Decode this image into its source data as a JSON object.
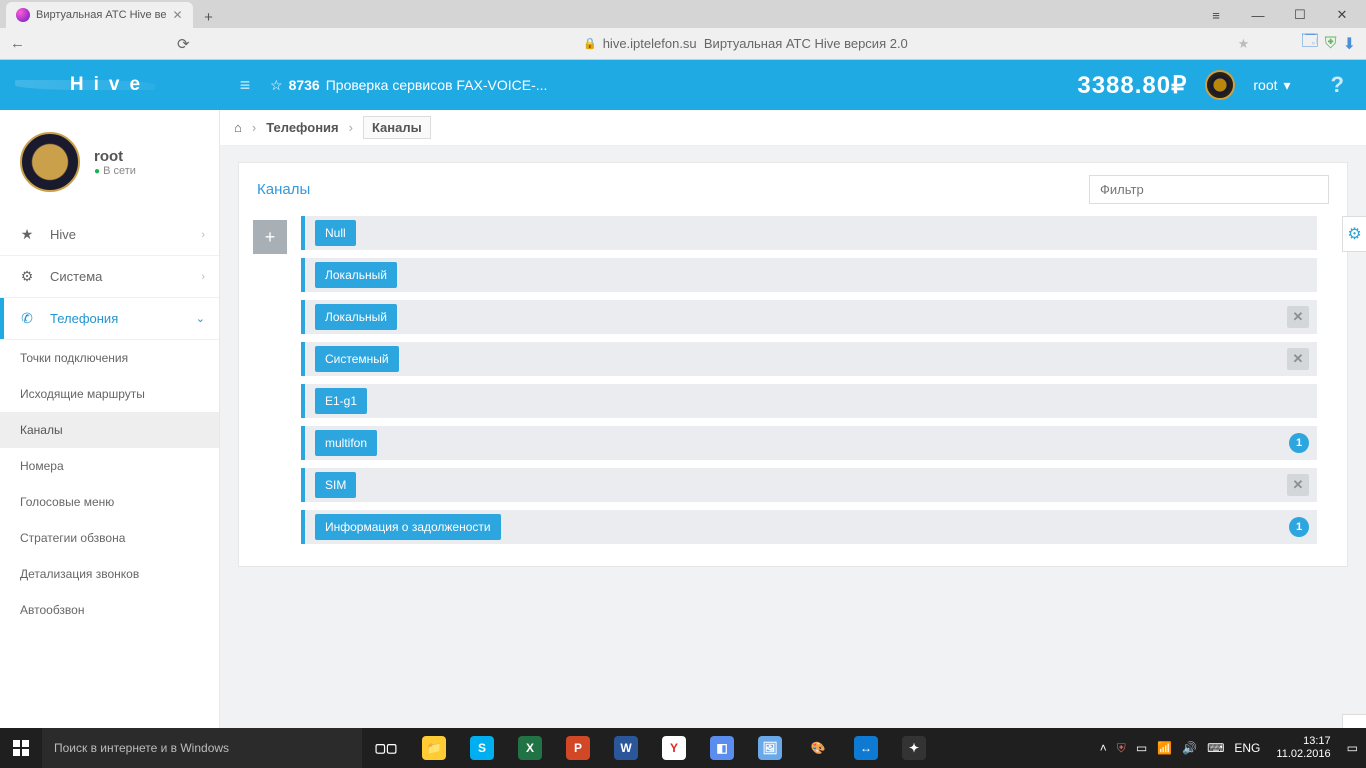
{
  "browser": {
    "tab_title": "Виртуальная АТС Hive ве",
    "address_host": "hive.iptelefon.su",
    "address_title": "Виртуальная АТС Hive версия 2.0"
  },
  "header": {
    "logo": "Hive",
    "ticker_id": "8736",
    "ticker_text": "Проверка сервисов FAX-VOICE-...",
    "balance": "3388.80₽",
    "username": "root"
  },
  "sidebar": {
    "user": {
      "name": "root",
      "status": "В сети"
    },
    "items": [
      {
        "icon": "★",
        "label": "Hive"
      },
      {
        "icon": "⚙",
        "label": "Система"
      },
      {
        "icon": "✆",
        "label": "Телефония"
      }
    ],
    "sub": [
      "Точки подключения",
      "Исходящие маршруты",
      "Каналы",
      "Номера",
      "Голосовые меню",
      "Стратегии обзвона",
      "Детализация звонков",
      "Автообзвон"
    ]
  },
  "breadcrumb": {
    "l1": "Телефония",
    "l2": "Каналы"
  },
  "panel": {
    "title": "Каналы",
    "filter_placeholder": "Фильтр",
    "rows": [
      {
        "label": "Null"
      },
      {
        "label": "Локальный"
      },
      {
        "label": "Локальный",
        "close": true
      },
      {
        "label": "Системный",
        "close": true
      },
      {
        "label": "E1-g1"
      },
      {
        "label": "multifon",
        "badge": "1"
      },
      {
        "label": "SIM",
        "close": true
      },
      {
        "label": "Информация о задолжености",
        "badge": "1"
      }
    ]
  },
  "taskbar": {
    "search_placeholder": "Поиск в интернете и в Windows",
    "lang": "ENG",
    "time": "13:17",
    "date": "11.02.2016"
  }
}
